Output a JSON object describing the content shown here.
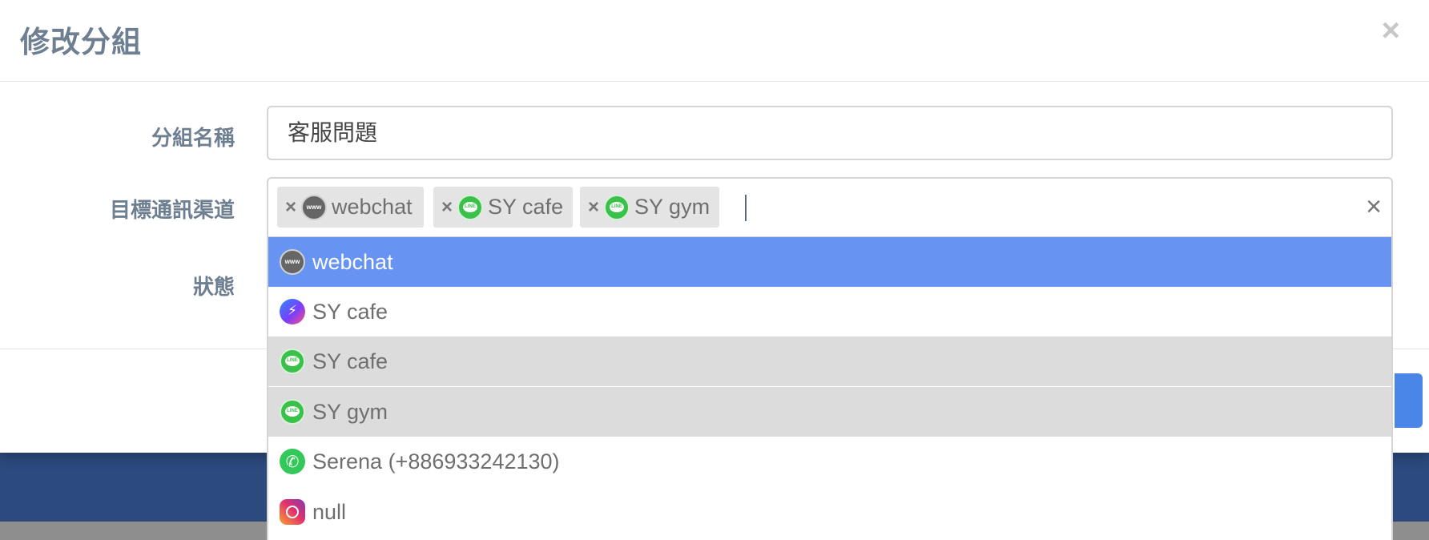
{
  "modal": {
    "title": "修改分組",
    "close_label": "×"
  },
  "form": {
    "group_name": {
      "label": "分組名稱",
      "value": "客服問題"
    },
    "channels": {
      "label": "目標通訊渠道",
      "tags": [
        {
          "remove": "×",
          "icon": "www-icon",
          "label": "webchat"
        },
        {
          "remove": "×",
          "icon": "line-icon",
          "label": "SY cafe"
        },
        {
          "remove": "×",
          "icon": "line-icon",
          "label": "SY gym"
        }
      ],
      "clear_label": "×"
    },
    "status": {
      "label": "狀態"
    }
  },
  "dropdown": {
    "options": [
      {
        "icon": "www-icon",
        "label": "webchat",
        "state": "highlighted"
      },
      {
        "icon": "messenger-icon",
        "label": "SY cafe",
        "state": "normal"
      },
      {
        "icon": "line-icon",
        "label": "SY cafe",
        "state": "selected"
      },
      {
        "icon": "line-icon",
        "label": "SY gym",
        "state": "selected"
      },
      {
        "icon": "whatsapp-icon",
        "label": "Serena (+886933242130)",
        "state": "normal"
      },
      {
        "icon": "instagram-icon",
        "label": "null",
        "state": "normal"
      }
    ]
  },
  "colors": {
    "highlight": "#6794f2",
    "selected": "#dcdcdc",
    "navy_background": "#2c4a7e",
    "primary_button": "#4a86e8"
  }
}
